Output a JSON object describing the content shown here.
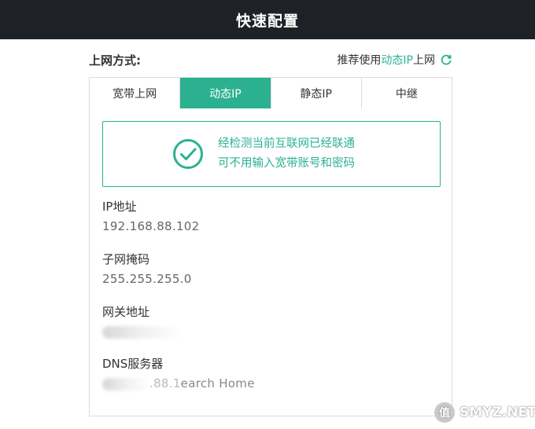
{
  "header": {
    "title": "快速配置"
  },
  "mode_row": {
    "label": "上网方式:",
    "recommend_prefix": "推荐使用",
    "recommend_mode": "动态IP",
    "recommend_suffix": "上网",
    "refresh_icon": "refresh-icon"
  },
  "tabs": [
    {
      "label": "宽带上网",
      "active": false
    },
    {
      "label": "动态IP",
      "active": true
    },
    {
      "label": "静态IP",
      "active": false
    },
    {
      "label": "中继",
      "active": false
    }
  ],
  "notice": {
    "icon": "check-circle-icon",
    "line1": "经检测当前互联网已经联通",
    "line2": "可不用输入宽带账号和密码"
  },
  "fields": {
    "ip": {
      "label": "IP地址",
      "value": "192.168.88.102"
    },
    "mask": {
      "label": "子网掩码",
      "value": "255.255.255.0"
    },
    "gateway": {
      "label": "网关地址",
      "value": ""
    },
    "dns": {
      "label": "DNS服务器",
      "value_visible": ".88.1",
      "value_suffix": "earch Home"
    }
  },
  "watermark": {
    "text": "SMYZ.NET"
  },
  "colors": {
    "accent": "#2bb190",
    "header_bg": "#1e2226",
    "border": "#dcdcdc"
  }
}
